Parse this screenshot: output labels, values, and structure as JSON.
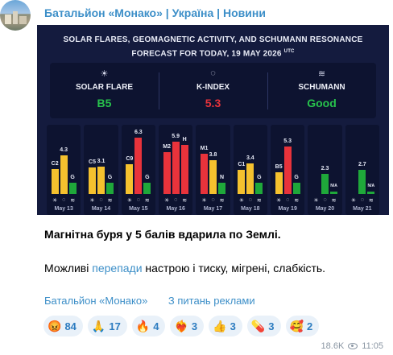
{
  "channel": {
    "name": "Батальйон «Монако» | Україна | Новини"
  },
  "card": {
    "title_line1": "SOLAR FLARES, GEOMAGNETIC ACTIVITY, AND SCHUMANN RESONANCE",
    "title_line2": "FORECAST FOR TODAY, 19 MAY 2026",
    "title_sup": "UTC",
    "summary": [
      {
        "icon": "sun-icon",
        "glyph": "☀",
        "label": "SOLAR FLARE",
        "value": "B5",
        "color": "#27c24c"
      },
      {
        "icon": "k-index-icon",
        "glyph": "◌",
        "label": "K-INDEX",
        "value": "5.3",
        "color": "#e8333b"
      },
      {
        "icon": "schumann-icon",
        "glyph": "≋",
        "label": "SCHUMANN",
        "value": "Good",
        "color": "#27c24c"
      }
    ]
  },
  "chart_data": {
    "type": "bar",
    "categories": [
      "May 13",
      "May 14",
      "May 15",
      "May 16",
      "May 17",
      "May 18",
      "May 19",
      "May 20",
      "May 21"
    ],
    "series": [
      {
        "name": "Solar flare",
        "labels": [
          "C2",
          "C5",
          "C9",
          "M2",
          "M1",
          "C1",
          "B5",
          "",
          ""
        ]
      },
      {
        "name": "K-index",
        "values": [
          4.3,
          3.1,
          6.3,
          5.9,
          3.8,
          3.4,
          5.3,
          2.3,
          2.7
        ]
      },
      {
        "name": "Schumann",
        "labels": [
          "G",
          "G",
          "G",
          "H",
          "N",
          "G",
          "G",
          "N/A",
          "N/A"
        ]
      }
    ],
    "colors": {
      "low": "#f5c12e",
      "high": "#e8333b",
      "good": "#1fa83a"
    },
    "icons": [
      "sun-icon",
      "k-index-icon",
      "schumann-icon"
    ]
  },
  "post": {
    "headline": "Магнітна буря у 5 балів вдарила по Землі.",
    "body_prefix": "Можливі ",
    "body_link": "перепади",
    "body_suffix": " настрою і тиску, мігрені, слабкість."
  },
  "links": [
    "Батальйон «Монако»",
    "З питань реклами"
  ],
  "reactions": [
    {
      "emoji": "😡",
      "count": "84",
      "icon": "angry-emoji-icon"
    },
    {
      "emoji": "🙏",
      "count": "17",
      "icon": "pray-emoji-icon"
    },
    {
      "emoji": "🔥",
      "count": "4",
      "icon": "fire-emoji-icon"
    },
    {
      "emoji": "❤️‍🔥",
      "count": "3",
      "icon": "heart-fire-emoji-icon"
    },
    {
      "emoji": "👍",
      "count": "3",
      "icon": "thumbs-up-emoji-icon"
    },
    {
      "emoji": "💊",
      "count": "3",
      "icon": "pill-emoji-icon"
    },
    {
      "emoji": "🥰",
      "count": "2",
      "icon": "smiling-hearts-emoji-icon"
    }
  ],
  "meta": {
    "views": "18.6K",
    "time": "11:05"
  }
}
